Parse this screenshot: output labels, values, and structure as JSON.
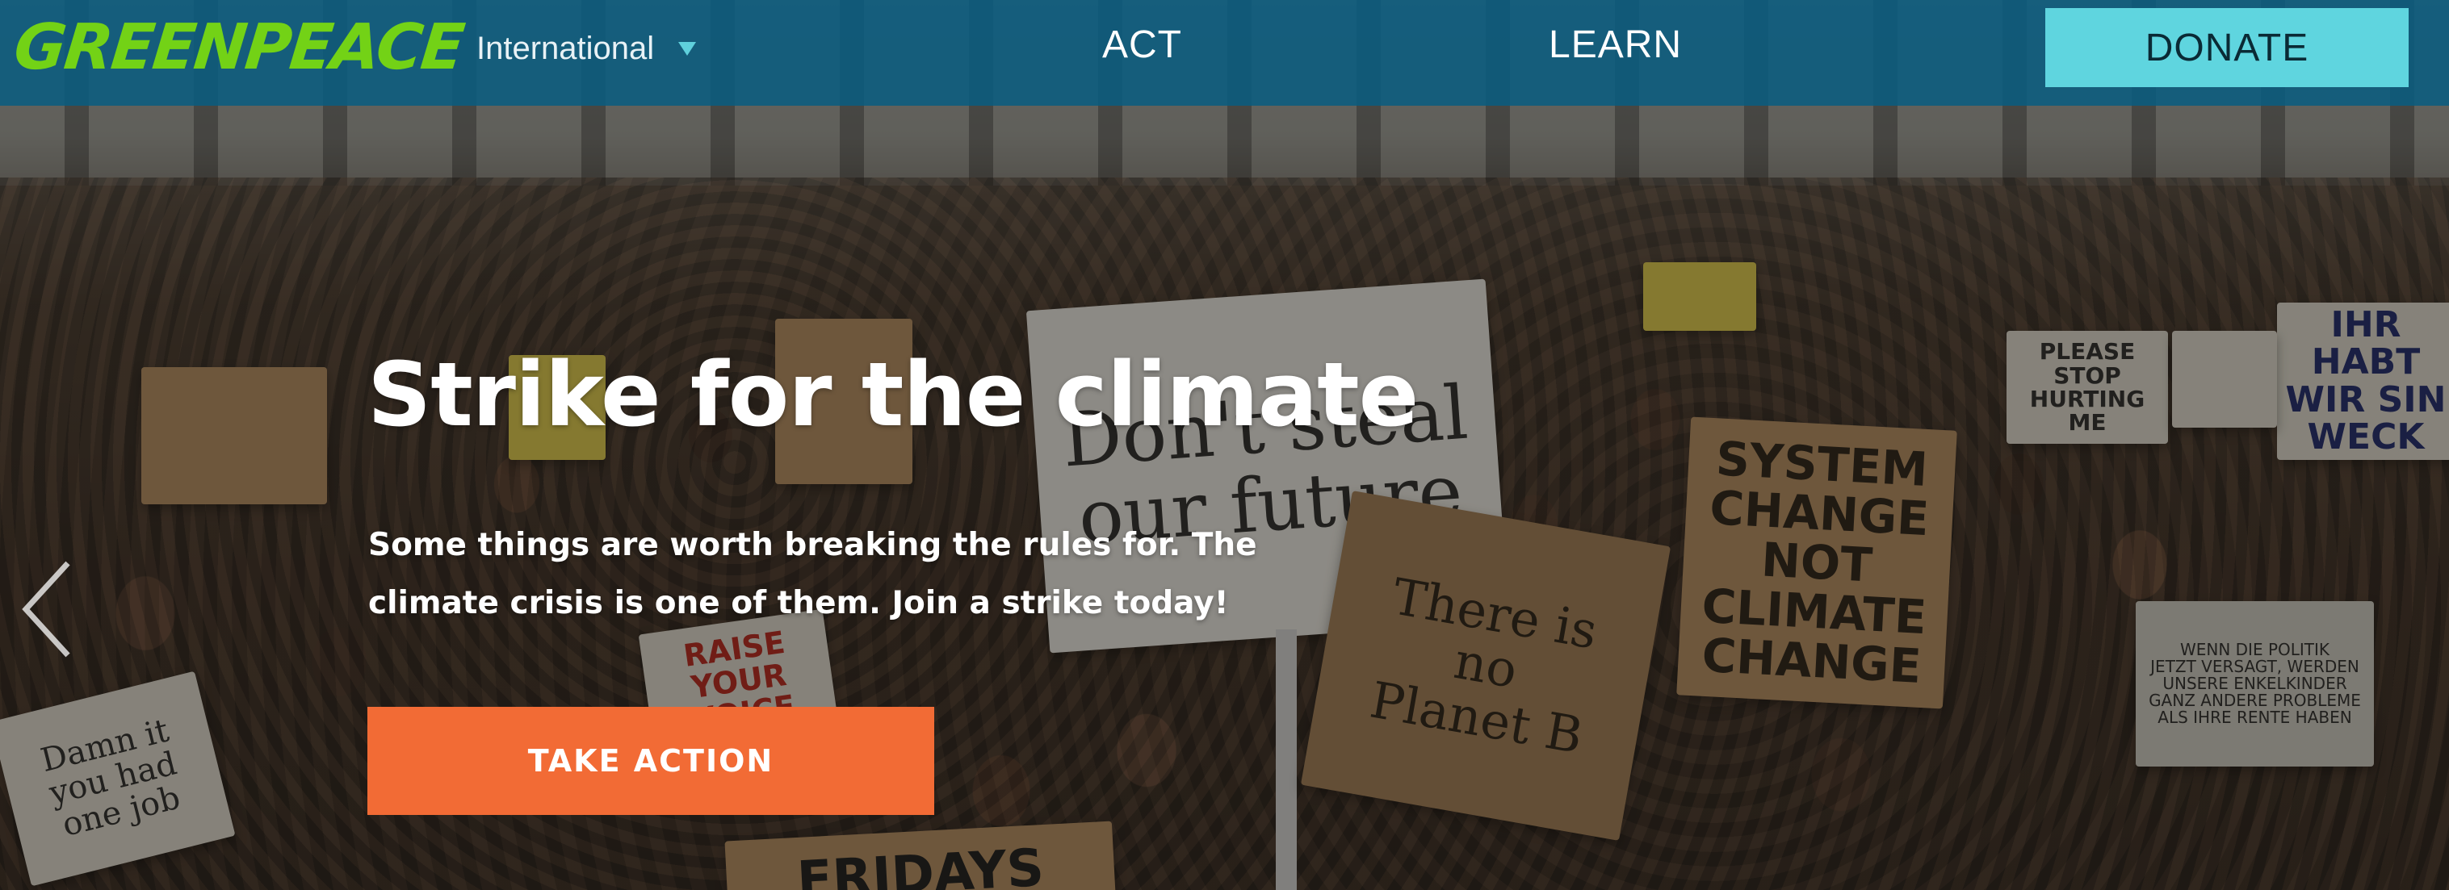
{
  "nav": {
    "logo_text": "GREENPEACE",
    "logo_color": "#73d216",
    "region_label": "International",
    "links": [
      {
        "label": "ACT"
      },
      {
        "label": "LEARN"
      }
    ],
    "donate_label": "DONATE",
    "donate_color": "#5fd5df",
    "bar_color": "#085c80"
  },
  "hero": {
    "title": "Strike for the climate",
    "description": "Some things are worth breaking the rules for. The climate crisis is one of them. Join a strike today!",
    "cta_label": "TAKE ACTION",
    "cta_color": "#f26b35",
    "prev_icon": "chevron-left-icon"
  },
  "signs": [
    {
      "text": "Don't steal\nour future"
    },
    {
      "text": "SYSTEM\nCHANGE\nNOT\nCLIMATE\nCHANGE"
    },
    {
      "text": "There is\nno\nPlanet B"
    },
    {
      "text": "PLEASE\nSTOP\nHURTING\nME"
    },
    {
      "text": "IHR HABT\nWIR SIN\nWECK"
    },
    {
      "text": "WENN DIE POLITIK\nJETZT VERSAGT, WERDEN\nUNSERE ENKELKINDER\nGANZ ANDERE PROBLEME\nALS IHRE RENTE HABEN"
    },
    {
      "text": "Damn it\nyou had\none job"
    },
    {
      "text": "RAISE\nYOUR\nVOICE"
    },
    {
      "text": "FRIDAYS"
    }
  ]
}
